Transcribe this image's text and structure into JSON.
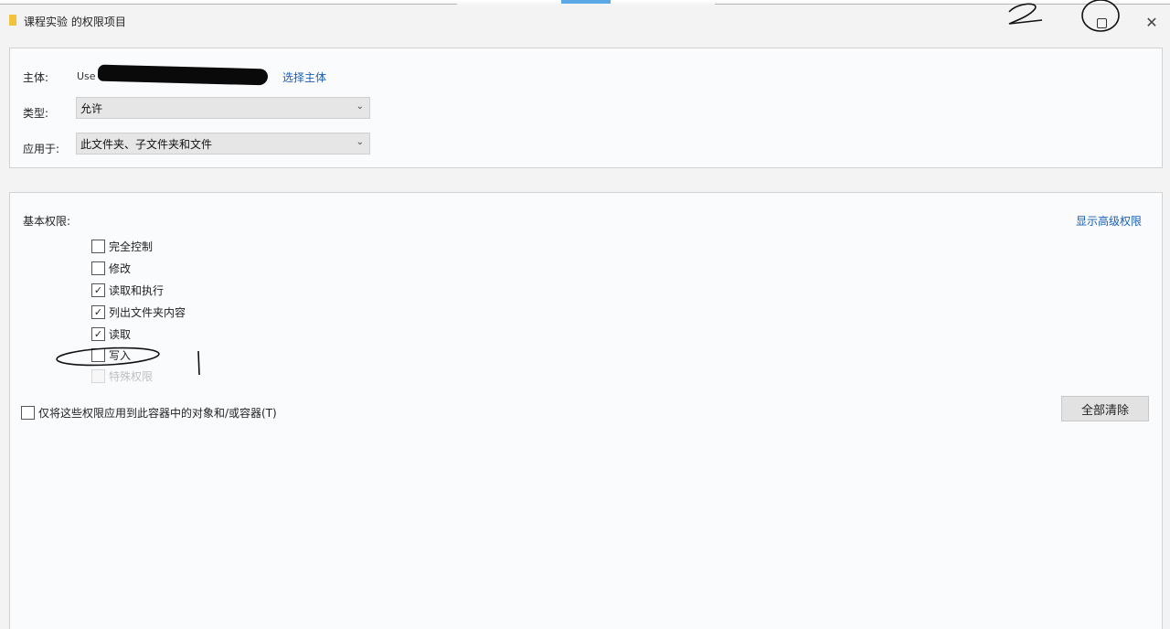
{
  "window": {
    "title": "课程实验 的权限项目"
  },
  "subject": {
    "label": "主体:",
    "value": "Use",
    "select_link": "选择主体"
  },
  "type": {
    "label": "类型:",
    "selected": "允许"
  },
  "applies_to": {
    "label": "应用于:",
    "selected": "此文件夹、子文件夹和文件"
  },
  "basic_permissions": {
    "heading": "基本权限:",
    "show_advanced_link": "显示高级权限",
    "items": [
      {
        "label": "完全控制",
        "checked": false,
        "enabled": true
      },
      {
        "label": "修改",
        "checked": false,
        "enabled": true
      },
      {
        "label": "读取和执行",
        "checked": true,
        "enabled": true
      },
      {
        "label": "列出文件夹内容",
        "checked": true,
        "enabled": true
      },
      {
        "label": "读取",
        "checked": true,
        "enabled": true
      },
      {
        "label": "写入",
        "checked": false,
        "enabled": true
      },
      {
        "label": "特殊权限",
        "checked": false,
        "enabled": false
      }
    ]
  },
  "apply_only": {
    "label": "仅将这些权限应用到此容器中的对象和/或容器(T)",
    "checked": false
  },
  "clear_all_button": "全部清除",
  "annotations": {
    "mark_one": "1",
    "mark_two": "2"
  },
  "icons": {
    "folder": "folder-icon",
    "maximize": "maximize-icon",
    "close": "close-icon",
    "chevron": "chevron-down-icon",
    "check": "checkmark-icon"
  }
}
